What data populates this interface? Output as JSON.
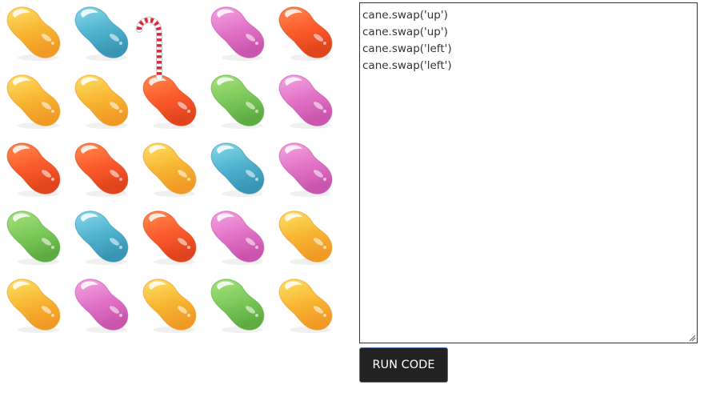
{
  "board": {
    "rows": [
      [
        "yellow",
        "blue",
        "empty",
        "pink",
        "orange"
      ],
      [
        "yellow",
        "yellow",
        "orange",
        "green",
        "pink"
      ],
      [
        "orange",
        "orange",
        "yellow",
        "blue",
        "pink"
      ],
      [
        "green",
        "blue",
        "orange",
        "pink",
        "yellow"
      ],
      [
        "yellow",
        "pink",
        "yellow",
        "green",
        "yellow"
      ]
    ],
    "cane": {
      "row": 1,
      "col": 2
    },
    "colors": {
      "yellow": {
        "base": "#f7b733",
        "light": "#ffe066",
        "dark": "#f09a26"
      },
      "blue": {
        "base": "#4fb3cf",
        "light": "#8ad8ea",
        "dark": "#3a95b5"
      },
      "pink": {
        "base": "#e173c6",
        "light": "#f4a6e2",
        "dark": "#c955ad"
      },
      "orange": {
        "base": "#fb5a2c",
        "light": "#ff8a4d",
        "dark": "#e0441c"
      },
      "green": {
        "base": "#7cc95a",
        "light": "#a8e27d",
        "dark": "#5eab42"
      }
    }
  },
  "editor": {
    "lines": [
      "cane.swap('up')",
      "cane.swap('up')",
      "cane.swap('left')",
      "cane.swap('left')"
    ]
  },
  "run_button": {
    "label": "RUN CODE"
  }
}
